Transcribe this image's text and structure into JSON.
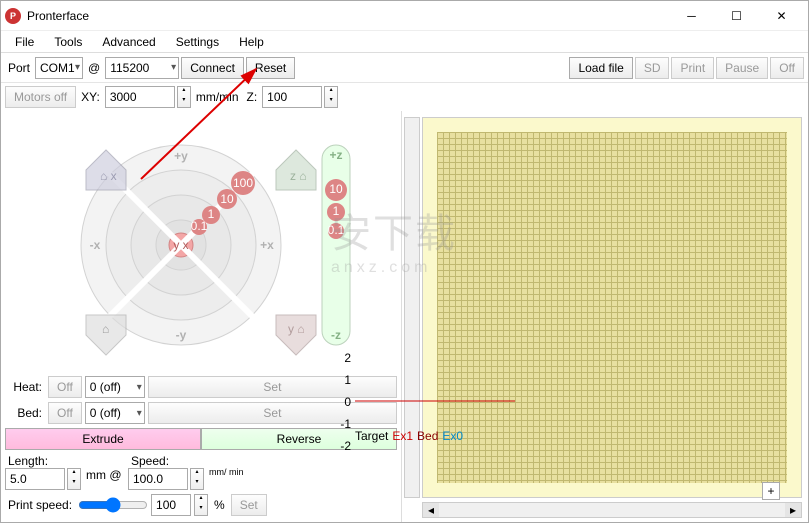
{
  "window": {
    "title": "Pronterface"
  },
  "menu": {
    "file": "File",
    "tools": "Tools",
    "advanced": "Advanced",
    "settings": "Settings",
    "help": "Help"
  },
  "toolbar": {
    "port_label": "Port",
    "port_value": "COM1",
    "at": "@",
    "baud_value": "115200",
    "connect": "Connect",
    "reset": "Reset",
    "load": "Load file",
    "sd": "SD",
    "print": "Print",
    "pause": "Pause",
    "off": "Off"
  },
  "row2": {
    "motors_off": "Motors off",
    "xy_label": "XY:",
    "xy_value": "3000",
    "mm_min": "mm/min",
    "z_label": "Z:",
    "z_value": "100"
  },
  "jog": {
    "rings": [
      "0.1",
      "1",
      "10",
      "100"
    ],
    "labels": {
      "xhome": "x",
      "yhome": "y",
      "zhome": "z",
      "plusx": "+x",
      "minusx": "-x",
      "plusy": "+y",
      "minusy": "-y",
      "plusz": "+z",
      "minusz": "-z"
    }
  },
  "heat": {
    "heat_label": "Heat:",
    "heat_off": "Off",
    "heat_val": "0 (off)",
    "heat_set": "Set",
    "bed_label": "Bed:",
    "bed_off": "Off",
    "bed_val": "0 (off)",
    "bed_set": "Set"
  },
  "extrude": {
    "ext": "Extrude",
    "rev": "Reverse"
  },
  "params": {
    "length_label": "Length:",
    "length_val": "5.0",
    "length_unit": "mm @",
    "speed_label": "Speed:",
    "speed_val": "100.0",
    "speed_unit": "mm/\nmin",
    "ps_label": "Print speed:",
    "ps_val": "100",
    "ps_unit": "%",
    "ps_set": "Set"
  },
  "chart_data": {
    "type": "line",
    "ylim": [
      -2,
      2
    ],
    "yticks": [
      2,
      1,
      0,
      -1,
      -2
    ],
    "series": [
      {
        "name": "Target",
        "color": "#000",
        "values": [
          0,
          0,
          0,
          0,
          0,
          0,
          0,
          0,
          0,
          0
        ]
      },
      {
        "name": "Ex1",
        "color": "#c00",
        "values": [
          0,
          0,
          0,
          0,
          0,
          0,
          0,
          0,
          0,
          0
        ]
      },
      {
        "name": "Bed",
        "color": "#800",
        "values": [
          0,
          0,
          0,
          0,
          0,
          0,
          0,
          0,
          0,
          0
        ]
      },
      {
        "name": "Ex0",
        "color": "#08c",
        "values": [
          0,
          0,
          0,
          0,
          0,
          0,
          0,
          0,
          0,
          0
        ]
      }
    ]
  },
  "viewer": {
    "add": "+"
  }
}
